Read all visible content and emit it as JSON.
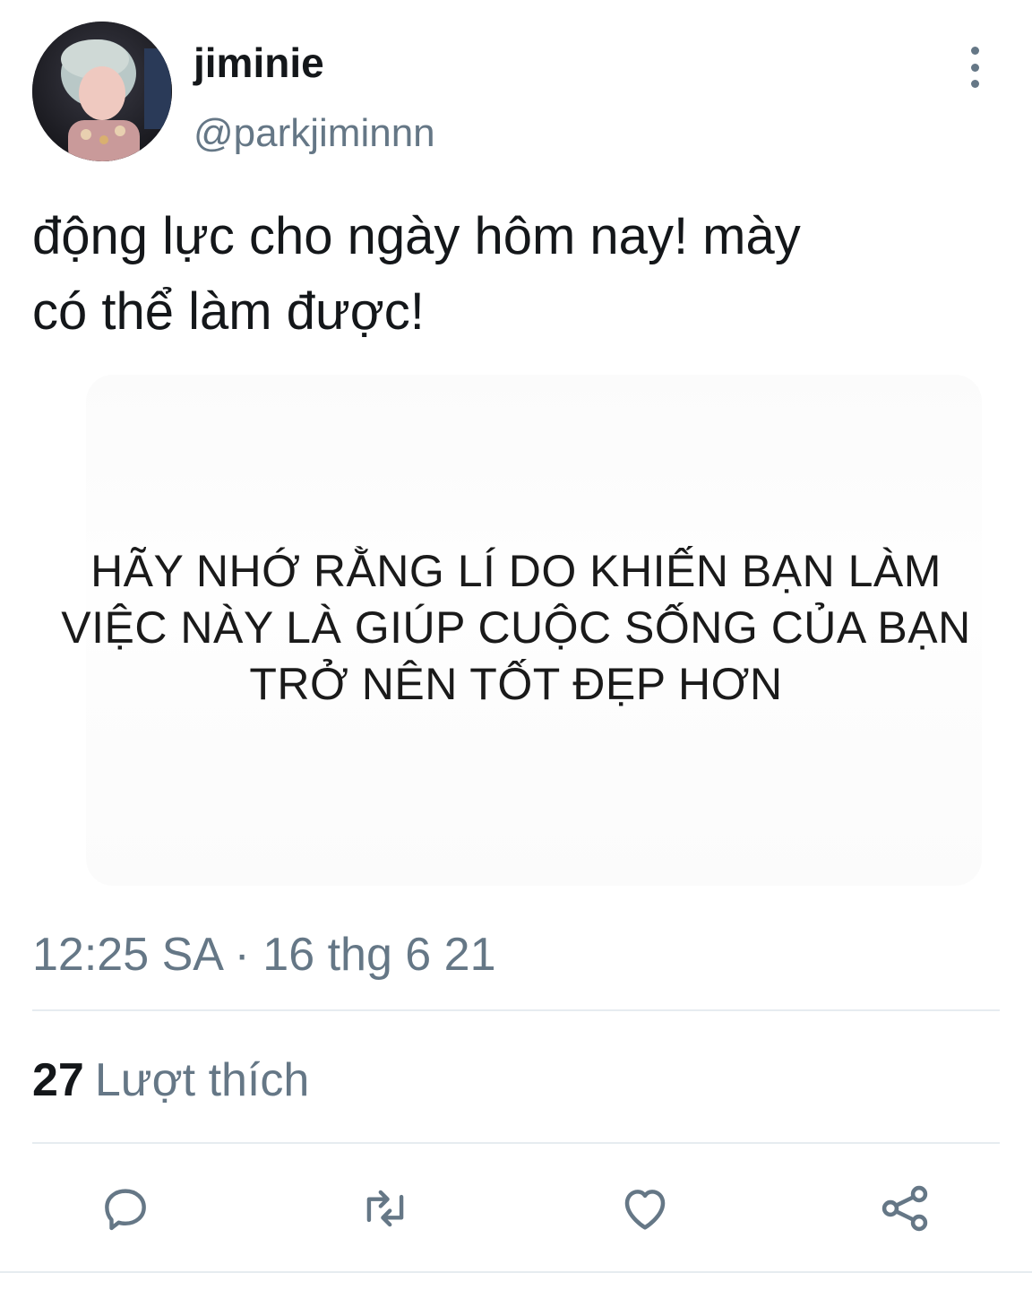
{
  "user": {
    "display_name": "jiminie",
    "handle": "@parkjiminnn",
    "avatar_icon": "profile-photo"
  },
  "tweet": {
    "text_line1": "động lực cho ngày hôm nay! mày",
    "text_line2": "có thể làm được!",
    "media_text_line1": "HÃY NHỚ RẰNG LÍ DO KHIẾN BẠN LÀM",
    "media_text_line2": "VIỆC NÀY LÀ GIÚP CUỘC SỐNG CỦA BẠN",
    "media_text_line3": "TRỞ NÊN TỐT ĐẸP HƠN",
    "timestamp": "12:25 SA · 16 thg 6 21"
  },
  "stats": {
    "likes_count": "27",
    "likes_label": "Lượt thích"
  },
  "actions": [
    {
      "icon": "reply-icon"
    },
    {
      "icon": "retweet-icon"
    },
    {
      "icon": "like-icon"
    },
    {
      "icon": "share-icon"
    }
  ],
  "colors": {
    "primary_text": "#14171a",
    "secondary_text": "#657786",
    "divider": "#e6ecf0",
    "background": "#ffffff"
  }
}
